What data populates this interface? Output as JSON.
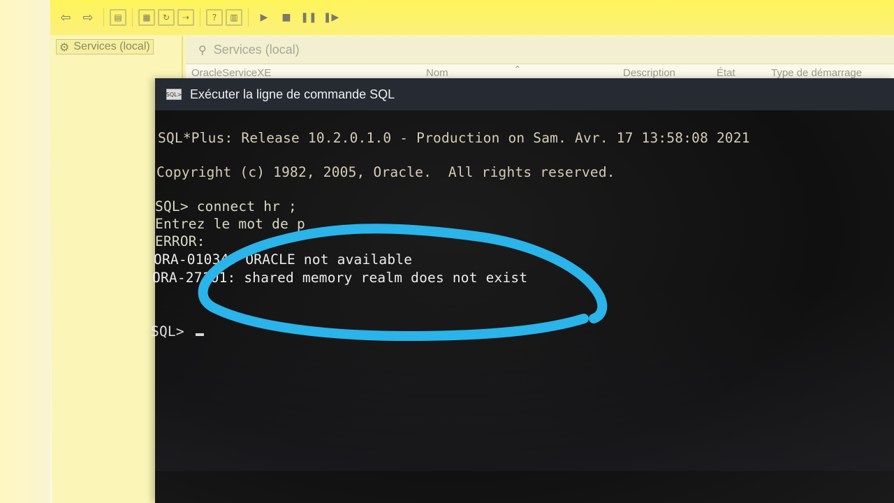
{
  "mmc": {
    "toolbar_icons": [
      "back-arrow-icon",
      "forward-arrow-icon",
      "show-hide-console-tree-icon",
      "properties-icon",
      "refresh-icon",
      "export-list-icon",
      "help-icon",
      "action-pane-icon",
      "start-service-icon",
      "stop-service-icon",
      "pause-service-icon",
      "restart-service-icon"
    ],
    "tree": {
      "item_label": "Services (local)"
    },
    "pane": {
      "header": "Services (local)",
      "columns": {
        "service": "OracleServiceXE",
        "name": "Nom",
        "description": "Description",
        "state": "État",
        "startup": "Type de démarrage"
      }
    }
  },
  "console": {
    "title": "Exécuter la ligne de commande SQL",
    "icon_label": "SQL>",
    "lines": {
      "release": "SQL*Plus: Release 10.2.0.1.0 - Production on Sam. Avr. 17 13:58:08 2021",
      "copyright": "Copyright (c) 1982, 2005, Oracle.  All rights reserved.",
      "connect": "SQL> connect hr ;",
      "password": "Entrez le mot de p",
      "error": "ERROR:",
      "ora1": "ORA-01034: ORACLE not available",
      "ora2": "ORA-27101: shared memory realm does not exist",
      "prompt": "SQL> "
    }
  },
  "colors": {
    "highlight": "#2ab4ea",
    "console_bg": "#0e0e0e",
    "title_bar": "#262a33",
    "toolbar": "#fff45a"
  }
}
